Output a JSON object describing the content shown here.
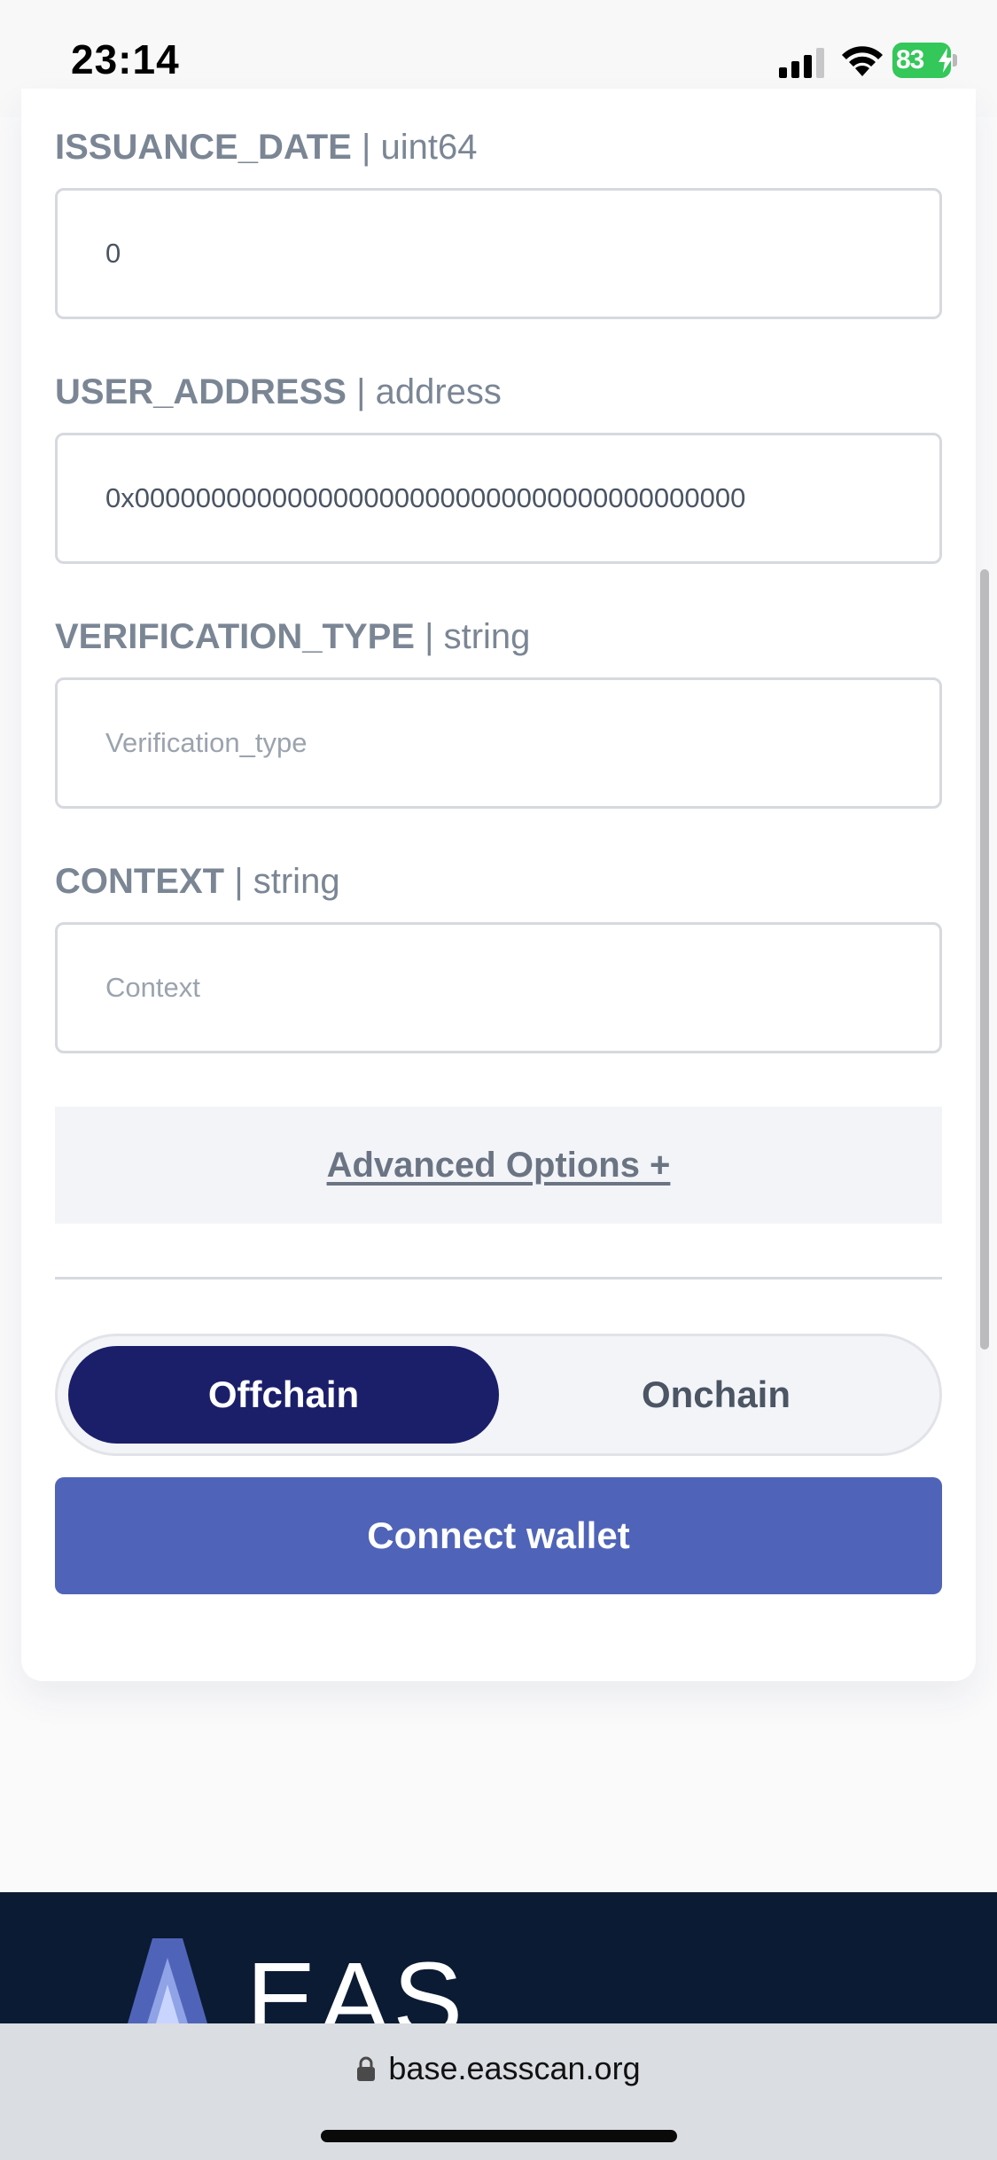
{
  "status_bar": {
    "time": "23:14",
    "battery": "83"
  },
  "form": {
    "fields": [
      {
        "name": "ISSUANCE_DATE",
        "type": "uint64",
        "value": "0",
        "placeholder": ""
      },
      {
        "name": "USER_ADDRESS",
        "type": "address",
        "value": "0x0000000000000000000000000000000000000000",
        "placeholder": ""
      },
      {
        "name": "VERIFICATION_TYPE",
        "type": "string",
        "value": "",
        "placeholder": "Verification_type"
      },
      {
        "name": "CONTEXT",
        "type": "string",
        "value": "",
        "placeholder": "Context"
      }
    ],
    "separator": " | ",
    "advanced_options_label": "Advanced Options +",
    "toggle": {
      "options": [
        "Offchain",
        "Onchain"
      ],
      "selected": "Offchain"
    },
    "connect_label": "Connect wallet"
  },
  "footer": {
    "logo_text": "EAS"
  },
  "browser": {
    "url": "base.easscan.org"
  },
  "colors": {
    "toggle_active": "#1b1f6a",
    "connect_button": "#4f64b8",
    "footer_bg": "#0b1b33",
    "label_text": "#7b8695"
  }
}
